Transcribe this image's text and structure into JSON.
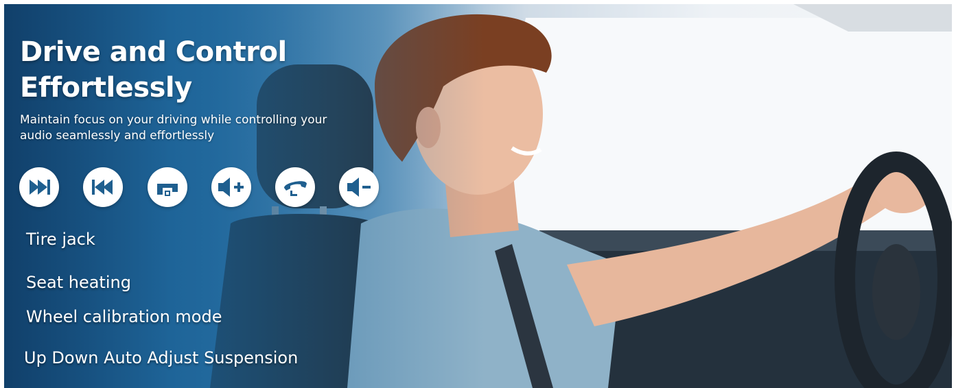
{
  "banner": {
    "title": "Drive and Control Effortlessly",
    "subtitle": "Maintain focus on your driving while controlling your audio seamlessly and effortlessly",
    "icons": [
      "next-track-icon",
      "previous-track-icon",
      "mode-icon",
      "volume-up-icon",
      "phone-answer-icon",
      "volume-down-icon"
    ],
    "features": [
      "Tire jack",
      "Seat heating",
      "Wheel calibration mode",
      "Up Down Auto Adjust Suspension"
    ],
    "colors": {
      "brand_dark": "#1a5586",
      "icon_fill": "#1f5f8f",
      "text": "#ffffff"
    }
  }
}
